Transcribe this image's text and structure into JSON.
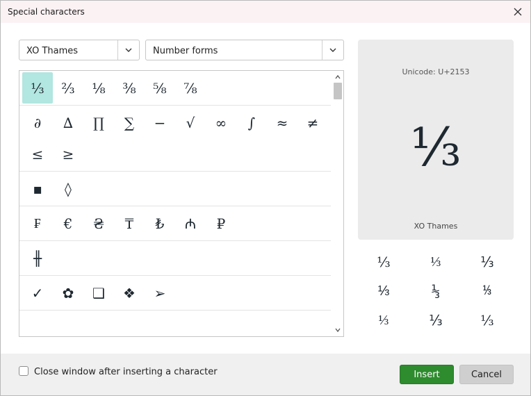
{
  "window": {
    "title": "Special characters"
  },
  "font_select": {
    "value": "XO Thames"
  },
  "subset_select": {
    "value": "Number forms"
  },
  "groups": [
    {
      "chars": [
        "⅓",
        "⅔",
        "⅛",
        "⅜",
        "⅝",
        "⅞"
      ]
    },
    {
      "chars": [
        "∂",
        "∆",
        "∏",
        "∑",
        "−",
        "√",
        "∞",
        "∫",
        "≈",
        "≠",
        "≤",
        "≥"
      ]
    },
    {
      "chars": [
        "▪",
        "◊"
      ]
    },
    {
      "chars": [
        "₣",
        "€",
        "₴",
        "₸",
        "₺",
        "₼",
        "₽"
      ]
    },
    {
      "chars": [
        "╫"
      ]
    },
    {
      "chars": [
        "✓",
        "✿",
        "❑",
        "❖",
        "➢"
      ]
    }
  ],
  "preview": {
    "unicode_label": "Unicode: U+2153",
    "glyph": "⅓",
    "font_name": "XO Thames"
  },
  "variants": [
    "⅓",
    "⅓",
    "⅓",
    "⅓",
    "⅓",
    "⅓",
    "⅓",
    "⅓",
    "⅓"
  ],
  "footer": {
    "close_after_insert_label": "Close window after inserting a character",
    "close_after_insert_checked": false,
    "insert_label": "Insert",
    "cancel_label": "Cancel"
  },
  "colors": {
    "accent": "#2e8b2e",
    "selected_cell": "#b2e6e0",
    "preview_bg": "#ebebeb"
  }
}
